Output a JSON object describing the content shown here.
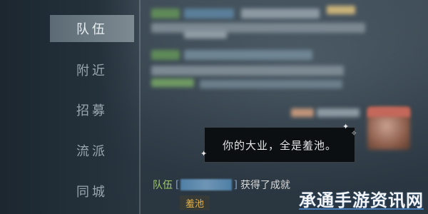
{
  "sidebar": {
    "items": [
      {
        "label": "队伍",
        "active": true
      },
      {
        "label": "附近",
        "active": false
      },
      {
        "label": "招募",
        "active": false
      },
      {
        "label": "流派",
        "active": false
      },
      {
        "label": "同城",
        "active": false
      }
    ]
  },
  "chat": {
    "bubble_text": "你的大业，全是羞池。",
    "system_line": {
      "channel_tag": "队伍",
      "bracket_open": "[",
      "bracket_close": "]",
      "message": "获得了成就",
      "achievement": "羞池"
    }
  },
  "watermark": "承通手游资讯网",
  "colors": {
    "team_tag": "#9ecb6a",
    "achievement": "#e2b04a",
    "active_tab_bg": "#7d8a92"
  }
}
